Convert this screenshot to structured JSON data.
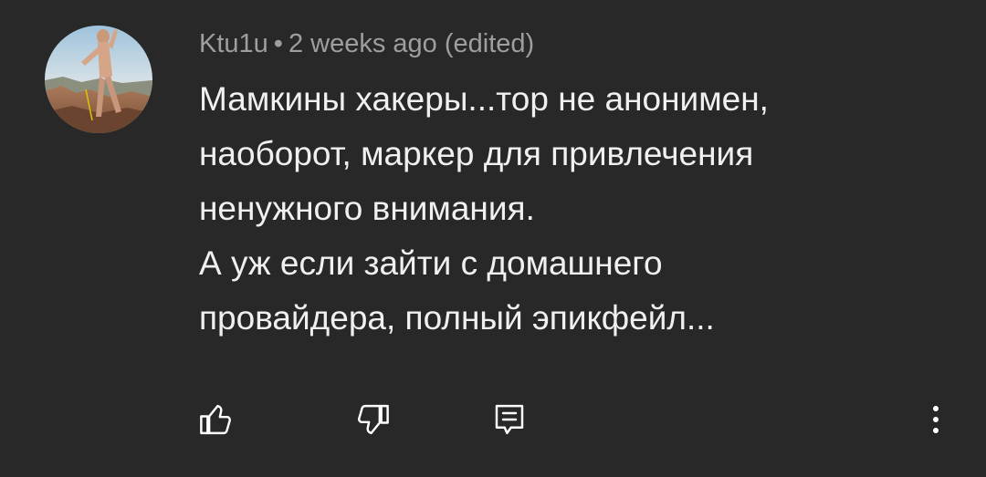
{
  "comment": {
    "author": "Ktu1u",
    "separator": "•",
    "time": "2 weeks ago",
    "edited": "(edited)",
    "text_lines": [
      "Мамкины хакеры...тор не анонимен,",
      "наоборот, маркер для привлечения",
      "ненужного внимания.",
      "А уж если зайти с домашнего",
      "провайдера, полный эпикфейл..."
    ]
  },
  "icons": {
    "like": "thumb-up-icon",
    "dislike": "thumb-down-icon",
    "reply": "reply-comment-icon",
    "more": "more-vertical-icon"
  },
  "colors": {
    "background": "#282828",
    "text": "#f0f0f0",
    "meta": "#9e9e9e",
    "icon": "#ffffff"
  }
}
